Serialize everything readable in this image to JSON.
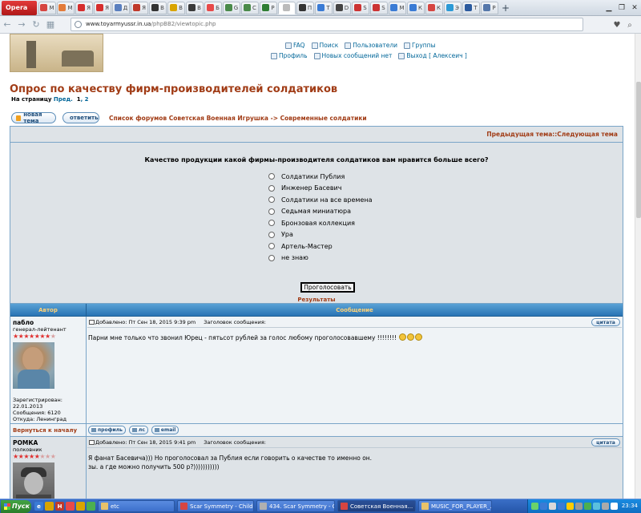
{
  "browser": {
    "menu_label": "Opera",
    "tabs": [
      {
        "letter": "М",
        "color": "#d64541"
      },
      {
        "letter": "M",
        "color": "#e37b3a"
      },
      {
        "letter": "Я",
        "color": "#d62d2d"
      },
      {
        "letter": "Я",
        "color": "#d62d2d"
      },
      {
        "letter": "Д",
        "color": "#5a7fbf"
      },
      {
        "letter": "Я",
        "color": "#c0392b"
      },
      {
        "letter": "В",
        "color": "#333333"
      },
      {
        "letter": "В",
        "color": "#d9a400"
      },
      {
        "letter": "В",
        "color": "#3a3a3a"
      },
      {
        "letter": "Б",
        "color": "#e84a4a"
      },
      {
        "letter": "G",
        "color": "#4a8a4a"
      },
      {
        "letter": "C",
        "color": "#4a8a4a"
      },
      {
        "letter": "Р",
        "color": "#2e7d32"
      },
      {
        "letter": "",
        "color": "#bbbbbb",
        "active": true
      },
      {
        "letter": "П",
        "color": "#333333"
      },
      {
        "letter": "Т",
        "color": "#3a7bd5"
      },
      {
        "letter": "D",
        "color": "#444444"
      },
      {
        "letter": "S",
        "color": "#cc3333"
      },
      {
        "letter": "S",
        "color": "#cc3333"
      },
      {
        "letter": "M",
        "color": "#3a7bd5"
      },
      {
        "letter": "К",
        "color": "#3a7bd5"
      },
      {
        "letter": "К",
        "color": "#d64541"
      },
      {
        "letter": "Э",
        "color": "#2c9ad6"
      },
      {
        "letter": "Т",
        "color": "#2b5a9e"
      },
      {
        "letter": "Р",
        "color": "#5577aa"
      }
    ],
    "new_tab": "+",
    "url_host": "www.toyarmyussr.in.ua",
    "url_path": "/phpBB2/viewtopic.php"
  },
  "header": {
    "links_row1": [
      {
        "label": "FAQ",
        "name": "faq-link"
      },
      {
        "label": "Поиск",
        "name": "search-link"
      },
      {
        "label": "Пользователи",
        "name": "members-link"
      },
      {
        "label": "Группы",
        "name": "groups-link"
      }
    ],
    "links_row2": [
      {
        "label": "Профиль",
        "name": "profile-link"
      },
      {
        "label": "Новых сообщений нет",
        "name": "new-messages-link"
      },
      {
        "label": "Выход [ Алексеич ]",
        "name": "logout-link"
      }
    ]
  },
  "topic": {
    "title": "Опрос по качеству фирм-производителей солдатиков",
    "pages_label": "На страницу",
    "prev_label": "Пред.",
    "page1": "1",
    "page2": ", 2",
    "new_topic_label": "новая тема",
    "reply_label": "ответить",
    "breadcrumb_root": "Список форумов Советская Военная Игрушка",
    "breadcrumb_sep": " -> ",
    "breadcrumb_forum": "Современные солдатики",
    "prev_topic": "Предыдущая тема",
    "nav_sep": " :: ",
    "next_topic": "Следующая тема"
  },
  "poll": {
    "question": "Качество продукции какой фирмы-производителя солдатиков вам нравится больше всего?",
    "options": [
      "Солдатики Публия",
      "Инженер Басевич",
      "Солдатики на все времена",
      "Седьмая миниатюра",
      "Бронзовая коллекция",
      "Ура",
      "Артель-Мастер",
      "не знаю"
    ],
    "vote_label": "Проголосовать",
    "results_label": "Результаты"
  },
  "table": {
    "col_author": "Автор",
    "col_message": "Сообщение"
  },
  "posts": [
    {
      "author": "пабло",
      "rank": "генерал-лейтенант",
      "stars_filled": "★★★★★★★",
      "stars_empty": "★",
      "posted": "Добавлено: Пт Сен 18, 2015 9:39 pm",
      "subject": "Заголовок сообщения:",
      "quote_label": "цитата",
      "text": "Парни мне только что звонил Юрец - пятьсот рублей за голос любому проголосовавшему !!!!!!!!",
      "registered": "Зарегистрирован: 22.01.2013",
      "messages": "Сообщения: 6120",
      "location": "Откуда: Ленинград"
    },
    {
      "author": "РОМКА",
      "rank": "полковник",
      "stars_filled": "★★★★★",
      "stars_empty": "★★★",
      "posted": "Добавлено: Пт Сен 18, 2015 9:41 pm",
      "subject": "Заголовок сообщения:",
      "quote_label": "цитата",
      "line1": "Я фанат Басевича))) Но проголосовал за Публия если говорить о качестве то именно он.",
      "line2": "зы. а где можно получить 500 р?)))))))))))"
    }
  ],
  "post_footer": {
    "back_to_top": "Вернуться к началу",
    "profile": "профиль",
    "pm": "лс",
    "email": "email"
  },
  "taskbar": {
    "start_label": "Пуск",
    "quicklaunch": [
      {
        "letter": "e",
        "color": "#3a7bd5"
      },
      {
        "letter": "",
        "color": "#d9a400"
      },
      {
        "letter": "H",
        "color": "#c0392b"
      },
      {
        "letter": "",
        "color": "#e84a4a"
      },
      {
        "letter": "",
        "color": "#d9a400"
      },
      {
        "letter": "",
        "color": "#4caf50"
      }
    ],
    "items": [
      {
        "label": "etc",
        "w": 96,
        "icon": "#e8c26a"
      },
      {
        "label": "Scar Symmetry - Children...",
        "w": 96,
        "icon": "#d64541"
      },
      {
        "label": "434. Scar Symmetry - Chil...",
        "w": 98,
        "icon": "#b0b0b0"
      },
      {
        "label": "Советская Военная...",
        "w": 98,
        "icon": "#d64541",
        "active": true
      },
      {
        "label": "MUSIC_FOR_PLAYER_...",
        "w": 92,
        "icon": "#e8c26a"
      }
    ],
    "tray_colors": [
      "#6ad36a",
      "#3a7bd5",
      "#d9d9d9",
      "#3a7bd5",
      "#ffcc00",
      "#999999",
      "#4caf50",
      "#5bc0de",
      "#aaaaaa",
      "#ffffff"
    ],
    "clock": "23:34"
  }
}
